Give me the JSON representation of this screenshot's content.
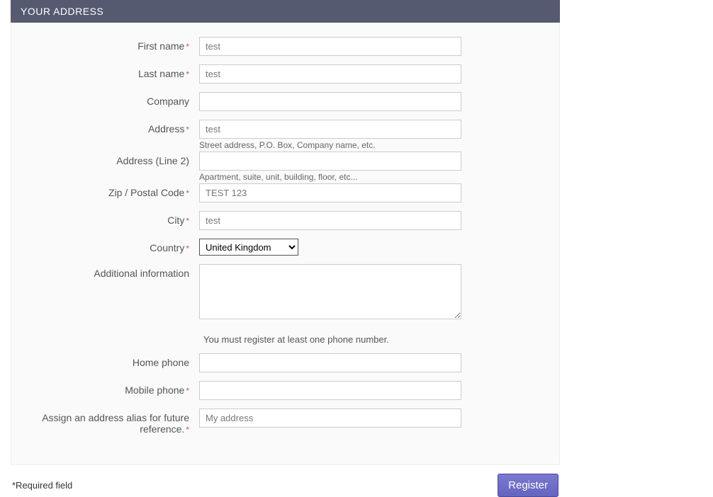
{
  "header": {
    "title": "YOUR ADDRESS"
  },
  "form": {
    "first_name": {
      "label": "First name",
      "value": "test",
      "required": true
    },
    "last_name": {
      "label": "Last name",
      "value": "test",
      "required": true
    },
    "company": {
      "label": "Company",
      "value": "",
      "required": false
    },
    "address": {
      "label": "Address",
      "value": "test",
      "required": true,
      "hint": "Street address, P.O. Box, Company name, etc."
    },
    "address2": {
      "label": "Address (Line 2)",
      "value": "",
      "required": false,
      "hint": "Apartment, suite, unit, building, floor, etc..."
    },
    "zip": {
      "label": "Zip / Postal Code",
      "value": "TEST 123",
      "required": true
    },
    "city": {
      "label": "City",
      "value": "test",
      "required": true
    },
    "country": {
      "label": "Country",
      "value": "United Kingdom",
      "required": true
    },
    "additional": {
      "label": "Additional information",
      "value": "",
      "required": false
    },
    "phone_notice": "You must register at least one phone number.",
    "home_phone": {
      "label": "Home phone",
      "value": "",
      "required": false
    },
    "mobile_phone": {
      "label": "Mobile phone",
      "value": "",
      "required": true
    },
    "alias": {
      "label": "Assign an address alias for future reference.",
      "value": "My address",
      "required": true
    }
  },
  "footer": {
    "required_note": "*Required field",
    "register_label": "Register"
  }
}
